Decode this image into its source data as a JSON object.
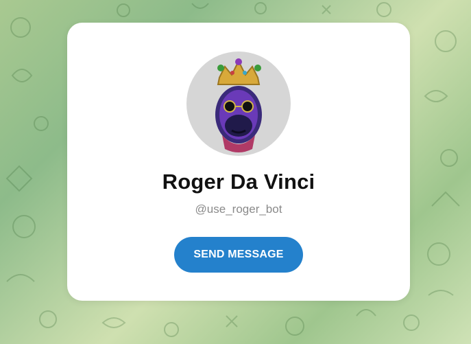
{
  "profile": {
    "name": "Roger Da Vinci",
    "username": "@use_roger_bot",
    "avatar_icon": "gorilla-king-avatar-icon"
  },
  "actions": {
    "send_message_label": "SEND MESSAGE"
  },
  "colors": {
    "accent": "#2481cc",
    "card": "#ffffff",
    "background": "#a9c991"
  }
}
